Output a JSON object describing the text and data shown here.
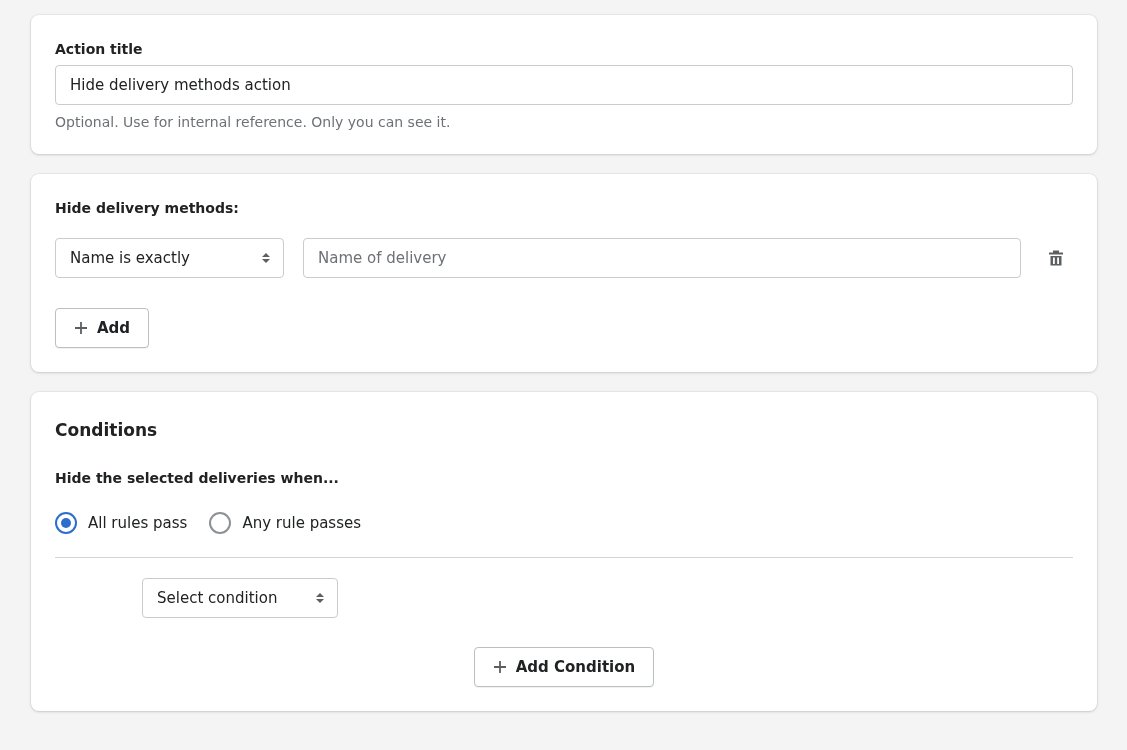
{
  "action_title": {
    "label": "Action title",
    "value": "Hide delivery methods action",
    "help": "Optional. Use for internal reference. Only you can see it."
  },
  "hide_methods": {
    "label": "Hide delivery methods:",
    "rules": [
      {
        "match": "Name is exactly",
        "placeholder": "Name of delivery"
      }
    ],
    "add_button": "Add"
  },
  "conditions": {
    "title": "Conditions",
    "subtitle": "Hide the selected deliveries when...",
    "options": [
      {
        "label": "All rules pass",
        "selected": true
      },
      {
        "label": "Any rule passes",
        "selected": false
      }
    ],
    "select": "Select condition",
    "add_button": "Add Condition"
  }
}
